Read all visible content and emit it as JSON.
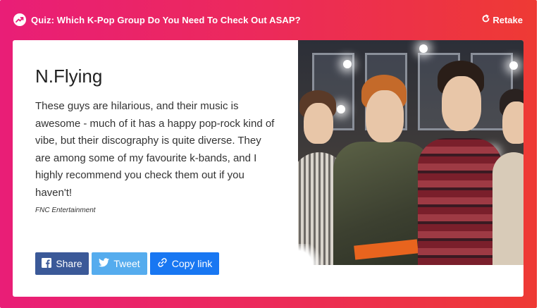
{
  "header": {
    "title": "Quiz: Which K-Pop Group Do You Need To Check Out ASAP?",
    "retake_label": "Retake",
    "trend_icon": "trending-icon",
    "retake_icon": "refresh-icon"
  },
  "result": {
    "title": "N.Flying",
    "description": "These guys are hilarious, and their music is awesome - much of it has a happy pop-rock kind of vibe, but their discography is quite diverse. They are among some of my favourite k-bands, and I highly recommend you check them out if you haven't!",
    "credit": "FNC Entertainment"
  },
  "share": {
    "facebook_label": "Share",
    "twitter_label": "Tweet",
    "copy_label": "Copy link"
  },
  "colors": {
    "gradient_start": "#e91e77",
    "gradient_end": "#ee3a34",
    "facebook": "#3b5998",
    "twitter": "#55acee",
    "copy_link": "#1877f2"
  }
}
